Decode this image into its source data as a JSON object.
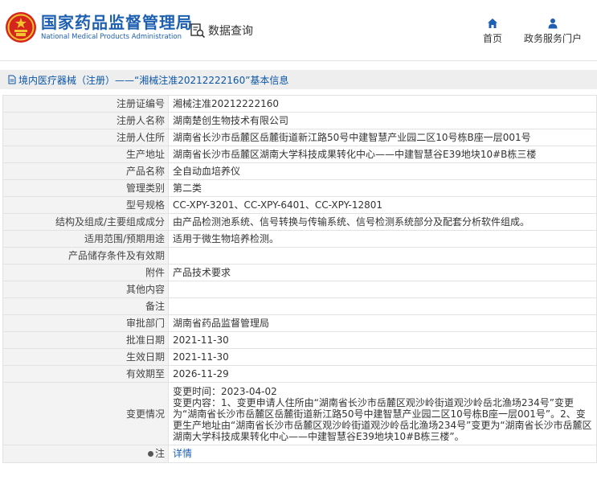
{
  "header": {
    "logo_cn": "国家药品监督管理局",
    "logo_en": "National Medical Products Administration",
    "query_label": "数据查询",
    "nav": [
      {
        "label": "首页",
        "icon": "home-icon"
      },
      {
        "label": "政务服务门户",
        "icon": "user-icon"
      }
    ]
  },
  "breadcrumb": {
    "text": "境内医疗器械（注册）——“湘械注准20212222160”基本信息"
  },
  "rows": [
    {
      "label": "注册证编号",
      "value": "湘械注准20212222160"
    },
    {
      "label": "注册人名称",
      "value": "湖南楚创生物技术有限公司"
    },
    {
      "label": "注册人住所",
      "value": "湖南省长沙市岳麓区岳麓街道新江路50号中建智慧产业园二区10号栋B座一层001号"
    },
    {
      "label": "生产地址",
      "value": "湖南省长沙市岳麓区湖南大学科技成果转化中心——中建智慧谷E39地块10#B栋三楼"
    },
    {
      "label": "产品名称",
      "value": "全自动血培养仪"
    },
    {
      "label": "管理类别",
      "value": "第二类"
    },
    {
      "label": "型号规格",
      "value": "CC-XPY-3201、CC-XPY-6401、CC-XPY-12801"
    },
    {
      "label": "结构及组成/主要组成成分",
      "value": "由产品检测池系统、信号转换与传输系统、信号检测系统部分及配套分析软件组成。"
    },
    {
      "label": "适用范围/预期用途",
      "value": "适用于微生物培养检测。"
    },
    {
      "label": "产品储存条件及有效期",
      "value": ""
    },
    {
      "label": "附件",
      "value": "产品技术要求"
    },
    {
      "label": "其他内容",
      "value": ""
    },
    {
      "label": "备注",
      "value": ""
    },
    {
      "label": "审批部门",
      "value": "湖南省药品监督管理局"
    },
    {
      "label": "批准日期",
      "value": "2021-11-30"
    },
    {
      "label": "生效日期",
      "value": "2021-11-30"
    },
    {
      "label": "有效期至",
      "value": "2026-11-29"
    }
  ],
  "change": {
    "label": "变更情况",
    "lines": [
      "变更时间：2023-04-02",
      "变更内容：1、变更申请人住所由“湖南省长沙市岳麓区观沙岭街道观沙岭岳北渔场234号”变更为“湖南省长沙市岳麓区岳麓街道新江路50号中建智慧产业园二区10号栋B座一层001号”。2、变更生产地址由“湖南省长沙市岳麓区观沙岭街道观沙岭岳北渔场234号”变更为“湖南省长沙市岳麓区湖南大学科技成果转化中心——中建智慧谷E39地块10#B栋三楼”。"
    ]
  },
  "note": {
    "label": "注",
    "link": "详情"
  },
  "colors": {
    "brand_blue": "#1d5fb0",
    "label_bg": "#f3f3f3",
    "border": "#e2e2e2"
  }
}
